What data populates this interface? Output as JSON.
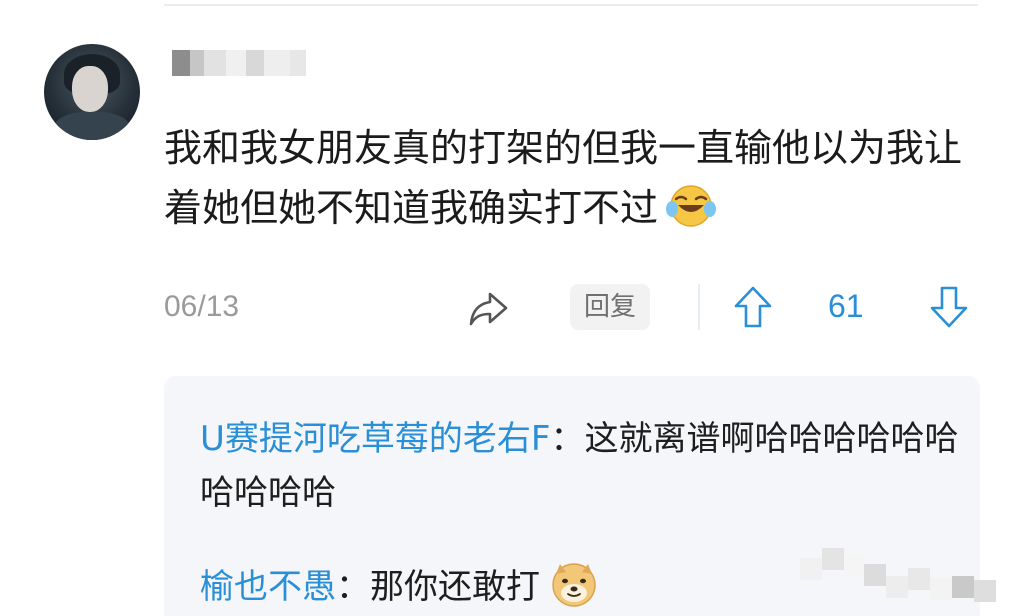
{
  "comment": {
    "text": "我和我女朋友真的打架的但我一直输他以为我让着她但她不知道我确实打不过",
    "emoji": "laughing-crying-emoji",
    "date": "06/13",
    "reply_label": "回复",
    "vote_count": "61"
  },
  "replies": [
    {
      "author": "U赛提河吃草莓的老右F",
      "separator": "：",
      "text": "这就离谱啊哈哈哈哈哈哈哈哈哈哈"
    },
    {
      "author": "榆也不愚",
      "separator": "：",
      "text": "那你还敢打",
      "emoji": "doge-emoji"
    }
  ],
  "colors": {
    "accent": "#2a8fd6",
    "reply_box_bg": "#f4f6f9",
    "meta_gray": "#9a9a9a"
  }
}
